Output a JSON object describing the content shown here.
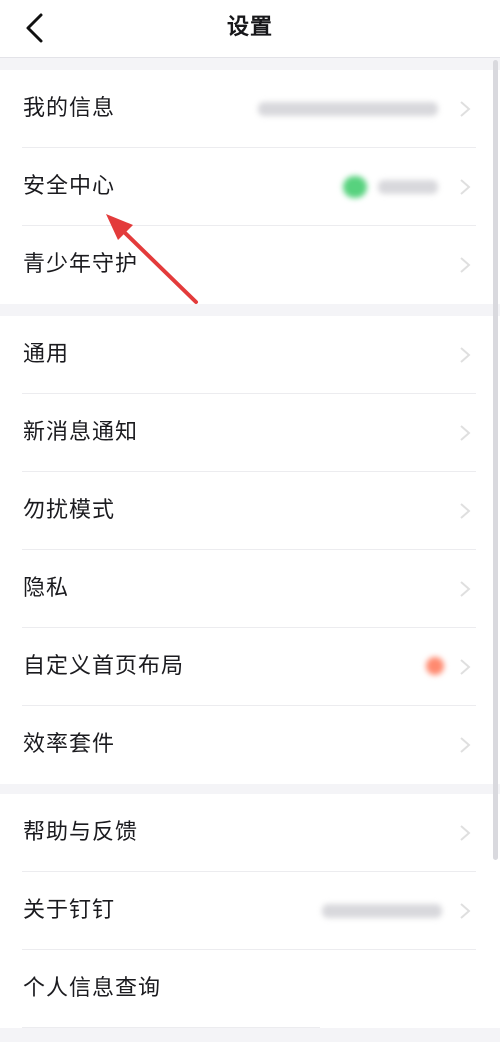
{
  "header": {
    "title": "设置"
  },
  "groups": [
    {
      "items": [
        {
          "label": "我的信息"
        },
        {
          "label": "安全中心"
        },
        {
          "label": "青少年守护"
        }
      ]
    },
    {
      "items": [
        {
          "label": "通用"
        },
        {
          "label": "新消息通知"
        },
        {
          "label": "勿扰模式"
        },
        {
          "label": "隐私"
        },
        {
          "label": "自定义首页布局"
        },
        {
          "label": "效率套件"
        }
      ]
    },
    {
      "items": [
        {
          "label": "帮助与反馈"
        },
        {
          "label": "关于钉钉"
        },
        {
          "label": "个人信息查询"
        }
      ]
    }
  ],
  "colors": {
    "background": "#f4f4f7",
    "surface": "#ffffff",
    "text": "#1b1b1f",
    "status_green": "#2ecc71",
    "badge_red": "#ff6a4d",
    "annotation_arrow": "#e33b3b"
  },
  "icons": {
    "back": "chevron-left-icon",
    "row_indicator": "chevron-right-icon"
  }
}
